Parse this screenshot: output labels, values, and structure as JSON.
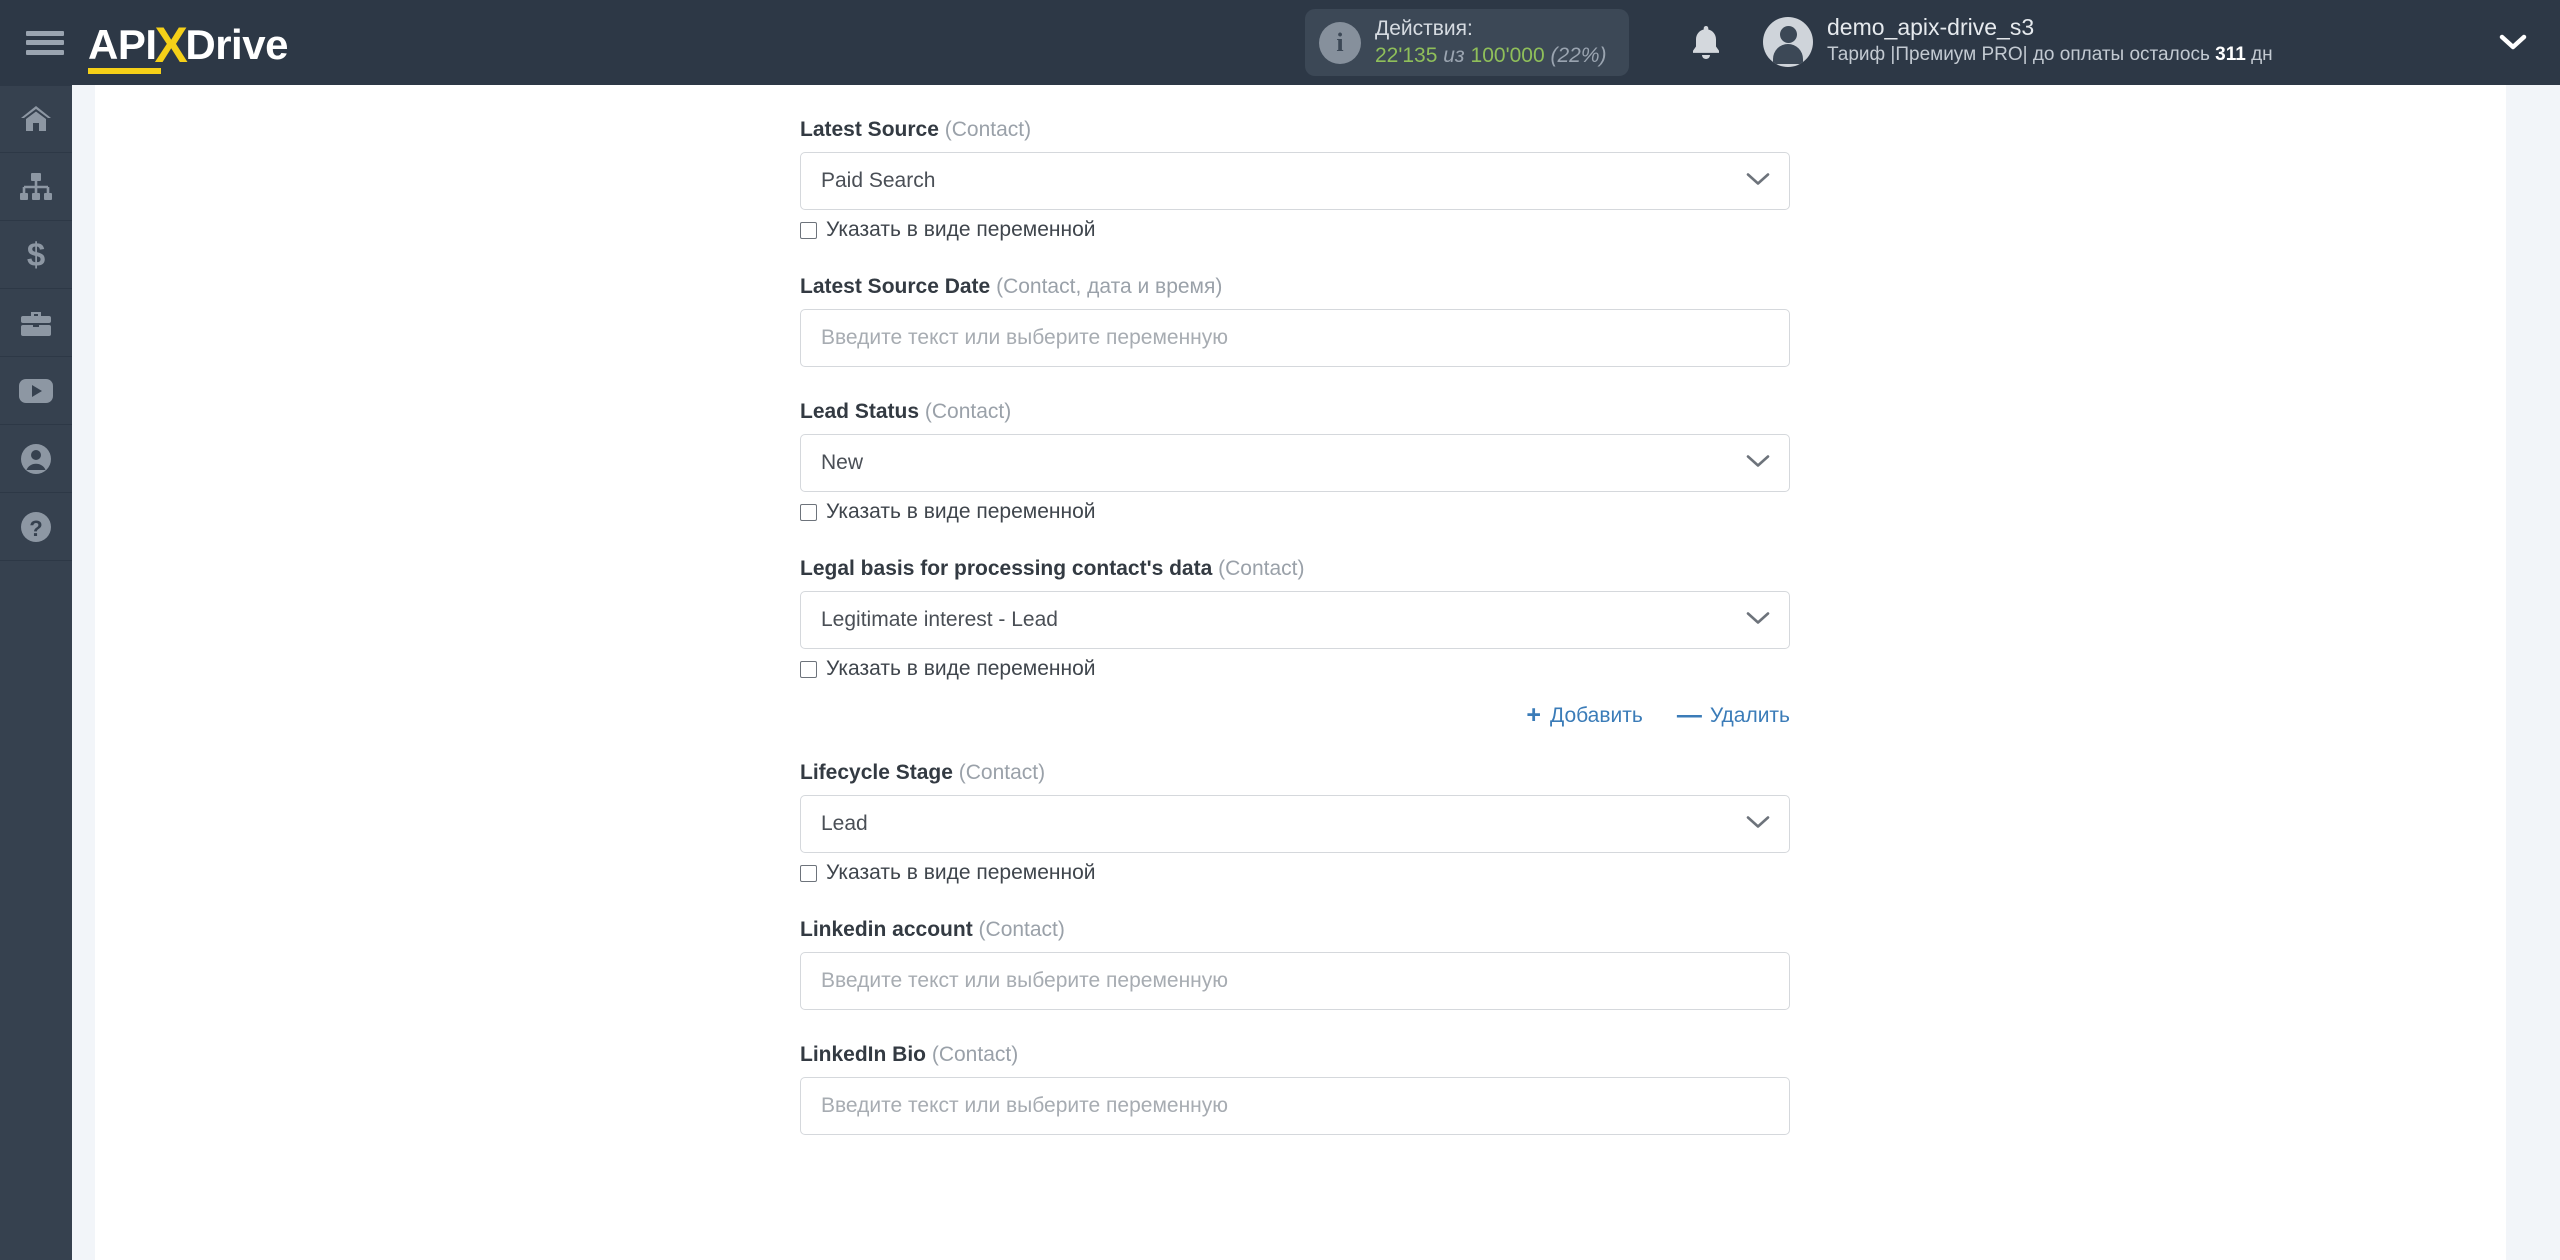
{
  "header": {
    "menu_icon": "hamburger-icon",
    "logo": {
      "part1": "API",
      "part2": "X",
      "part3": "Drive"
    },
    "actions": {
      "icon": "info-icon",
      "title": "Действия:",
      "used": "22'135",
      "of_word": "из",
      "total": "100'000",
      "percent": "(22%)",
      "percent_value": 22,
      "counter_color": "#8fbf5a"
    },
    "bell_icon": "bell-icon",
    "avatar_icon": "user-avatar-icon",
    "user": {
      "name": "demo_apix-drive_s3",
      "plan_prefix": "Тариф |Премиум PRO| до оплаты осталось ",
      "plan_days": "311",
      "plan_suffix": " дн"
    },
    "caret_icon": "chevron-down-icon"
  },
  "sidebar": {
    "items": [
      {
        "name": "home",
        "icon": "home-icon"
      },
      {
        "name": "connections",
        "icon": "sitemap-icon"
      },
      {
        "name": "billing",
        "icon": "dollar-icon"
      },
      {
        "name": "business",
        "icon": "briefcase-icon"
      },
      {
        "name": "video",
        "icon": "youtube-icon"
      },
      {
        "name": "account",
        "icon": "user-circle-icon"
      },
      {
        "name": "help",
        "icon": "question-circle-icon"
      }
    ]
  },
  "form": {
    "placeholder": "Введите текст или выберите переменную",
    "variable_checkbox_label": "Указать в виде переменной",
    "entity_contact": "(Contact)",
    "entity_contact_datetime": "(Contact, дата и время)",
    "add_label": "Добавить",
    "delete_label": "Удалить",
    "add_symbol": "+",
    "delete_symbol": "—",
    "link_color": "#3b7cb8",
    "fields": [
      {
        "label": "Latest Source",
        "entity": "(Contact)",
        "type": "select",
        "value": "Paid Search",
        "has_variable_checkbox": true,
        "checked": false
      },
      {
        "label": "Latest Source Date",
        "entity": "(Contact, дата и время)",
        "type": "text",
        "value": "",
        "placeholder": "Введите текст или выберите переменную",
        "has_variable_checkbox": false
      },
      {
        "label": "Lead Status",
        "entity": "(Contact)",
        "type": "select",
        "value": "New",
        "has_variable_checkbox": true,
        "checked": false
      },
      {
        "label": "Legal basis for processing contact's data",
        "entity": "(Contact)",
        "type": "select",
        "value": "Legitimate interest - Lead",
        "has_variable_checkbox": true,
        "checked": false
      },
      {
        "label": "Lifecycle Stage",
        "entity": "(Contact)",
        "type": "select",
        "value": "Lead",
        "has_variable_checkbox": true,
        "checked": false
      },
      {
        "label": "Linkedin account",
        "entity": "(Contact)",
        "type": "text",
        "value": "",
        "placeholder": "Введите текст или выберите переменную",
        "has_variable_checkbox": false
      },
      {
        "label": "LinkedIn Bio",
        "entity": "(Contact)",
        "type": "text",
        "value": "",
        "placeholder": "Введите текст или выберите переменную",
        "has_variable_checkbox": false
      }
    ]
  }
}
